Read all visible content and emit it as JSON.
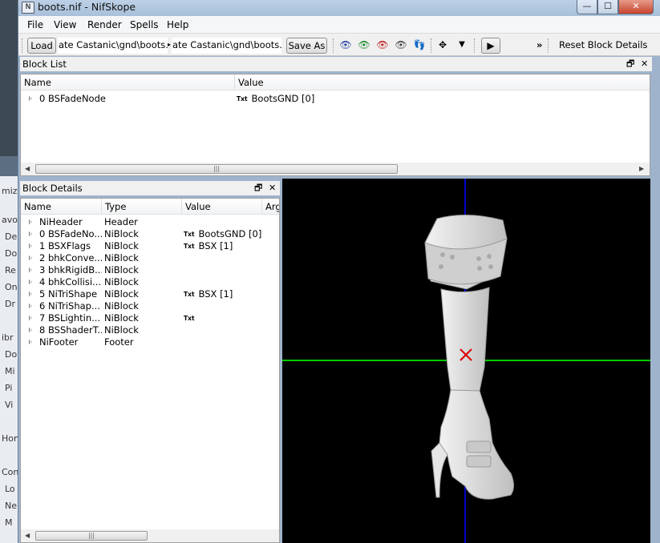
{
  "background_fragments": [
    "mize",
    "avo",
    "De",
    "Do",
    "Re",
    "On",
    "Dr",
    "ibr",
    "Do",
    "Mi",
    "Pi",
    "Vi",
    "Hon",
    "Con",
    "Lo",
    "Ne",
    "M"
  ],
  "window": {
    "title": "boots.nif - NifSkope",
    "app_icon": "N",
    "controls": {
      "minimize": "—",
      "maximize": "☐",
      "close": "✕"
    }
  },
  "menu": [
    "File",
    "View",
    "Render",
    "Spells",
    "Help"
  ],
  "toolbar": {
    "load_label": "Load",
    "load_path": "ate Castanic\\gnd\\boots.nif",
    "save_path": "ate Castanic\\gnd\\boots.nif",
    "save_as_label": "Save As",
    "more_glyph": "»",
    "reset_label": "Reset Block Details",
    "icons": [
      {
        "name": "view-top-icon",
        "glyph": "👁",
        "color": "#2a46a8"
      },
      {
        "name": "view-front-icon",
        "glyph": "👁",
        "color": "#1f8a2a"
      },
      {
        "name": "view-side-icon",
        "glyph": "👁",
        "color": "#c42020"
      },
      {
        "name": "view-user-icon",
        "glyph": "👁",
        "color": "#444444"
      },
      {
        "name": "walk-icon",
        "glyph": "👣",
        "color": "#333333"
      },
      {
        "name": "move-axes-icon",
        "glyph": "✥",
        "color": "#333333"
      },
      {
        "name": "dropdown-icon",
        "glyph": "▼",
        "color": "#333333"
      },
      {
        "name": "play-icon",
        "glyph": "▶",
        "color": "#333333"
      }
    ]
  },
  "block_list": {
    "title": "Block List",
    "headers": {
      "name": "Name",
      "value": "Value"
    },
    "rows": [
      {
        "name": "0 BSFadeNode",
        "badge": "Txt",
        "value": "BootsGND [0]"
      }
    ],
    "float_glyph": "🗗",
    "close_glyph": "✕"
  },
  "block_details": {
    "title": "Block Details",
    "headers": {
      "name": "Name",
      "type": "Type",
      "value": "Value",
      "arg": "Arg"
    },
    "rows": [
      {
        "name": "NiHeader",
        "type": "Header",
        "badge": "",
        "value": ""
      },
      {
        "name": "0 BSFadeNo...",
        "type": "NiBlock",
        "badge": "Txt",
        "value": "BootsGND [0]"
      },
      {
        "name": "1 BSXFlags",
        "type": "NiBlock",
        "badge": "Txt",
        "value": "BSX [1]"
      },
      {
        "name": "2 bhkConve...",
        "type": "NiBlock",
        "badge": "",
        "value": ""
      },
      {
        "name": "3 bhkRigidB...",
        "type": "NiBlock",
        "badge": "",
        "value": ""
      },
      {
        "name": "4 bhkCollisi...",
        "type": "NiBlock",
        "badge": "",
        "value": ""
      },
      {
        "name": "5 NiTriShape",
        "type": "NiBlock",
        "badge": "Txt",
        "value": "BSX [1]"
      },
      {
        "name": "6 NiTriShap...",
        "type": "NiBlock",
        "badge": "",
        "value": ""
      },
      {
        "name": "7 BSLightin...",
        "type": "NiBlock",
        "badge": "Txt",
        "value": ""
      },
      {
        "name": "8 BSShaderT...",
        "type": "NiBlock",
        "badge": "",
        "value": ""
      },
      {
        "name": "NiFooter",
        "type": "Footer",
        "badge": "",
        "value": ""
      }
    ],
    "float_glyph": "🗗",
    "close_glyph": "✕"
  },
  "scroll": {
    "grip": "|||",
    "left_arrow": "◀",
    "right_arrow": "▶"
  },
  "viewport": {
    "background": "#000000",
    "x_axis_color": "#00cc00",
    "y_axis_color": "#0000cc",
    "origin_marker_color": "#dd0000",
    "model_color": "#d8d8d8"
  }
}
